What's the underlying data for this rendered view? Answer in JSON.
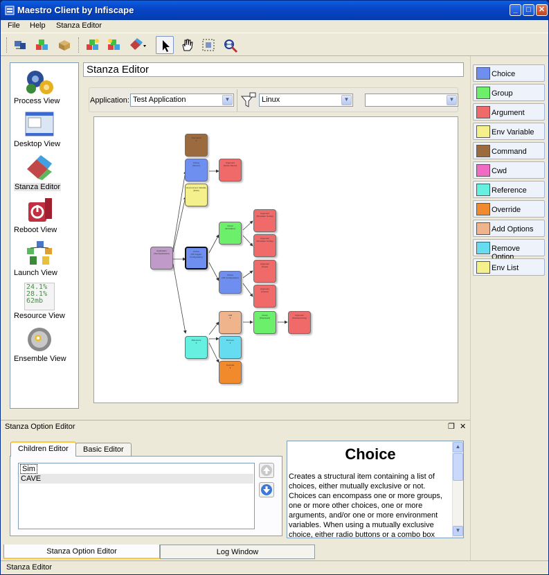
{
  "window": {
    "title": "Maestro Client by Infiscape"
  },
  "menu": [
    "File",
    "Help",
    "Stanza Editor"
  ],
  "nav": [
    {
      "label": "Process View",
      "icon": "gears-icon"
    },
    {
      "label": "Desktop View",
      "icon": "desktop-icon"
    },
    {
      "label": "Stanza Editor",
      "icon": "stanza-editor-icon"
    },
    {
      "label": "Reboot View",
      "icon": "reboot-icon"
    },
    {
      "label": "Launch View",
      "icon": "launch-icon"
    },
    {
      "label": "Resource View",
      "icon": "resource-icon",
      "stats": [
        "24.1%",
        "28.1%",
        "62mb"
      ]
    },
    {
      "label": "Ensemble View",
      "icon": "ensemble-icon"
    }
  ],
  "editor": {
    "title": "Stanza Editor",
    "application_label": "Application:",
    "application_value": "Test Application",
    "platform_value": "Linux",
    "third_value": ""
  },
  "palette": [
    {
      "label": "Choice",
      "color": "#6f8ff0"
    },
    {
      "label": "Group",
      "color": "#6cf06c"
    },
    {
      "label": "Argument",
      "color": "#f06a6a"
    },
    {
      "label": "Env Variable",
      "color": "#f4f08c"
    },
    {
      "label": "Command",
      "color": "#9c6a3f"
    },
    {
      "label": "Cwd",
      "color": "#f06cc4"
    },
    {
      "label": "Reference",
      "color": "#66f0e0"
    },
    {
      "label": "Override",
      "color": "#f08a2c"
    },
    {
      "label": "Add Options",
      "color": "#f0b48c"
    },
    {
      "label": "Remove Option",
      "color": "#66dcf0"
    },
    {
      "label": "Env List",
      "color": "#f4f08c"
    }
  ],
  "dock": {
    "title": "Stanza Option Editor"
  },
  "option_tabs": [
    "Children Editor",
    "Basic Editor"
  ],
  "children": [
    "Sim",
    "CAVE"
  ],
  "help": {
    "title": "Choice",
    "text": "Creates a structural item containing a list of choices, either mutually exclusive or not. Choices can encompass one or more groups, one or more other choices, one or more arguments, and/or one or more environment variables. When using a mutually exclusive choice, either radio buttons or a combo box"
  },
  "bottom_tabs": [
    "Stanza Option Editor",
    "Log Window"
  ],
  "status": "Stanza Editor"
}
